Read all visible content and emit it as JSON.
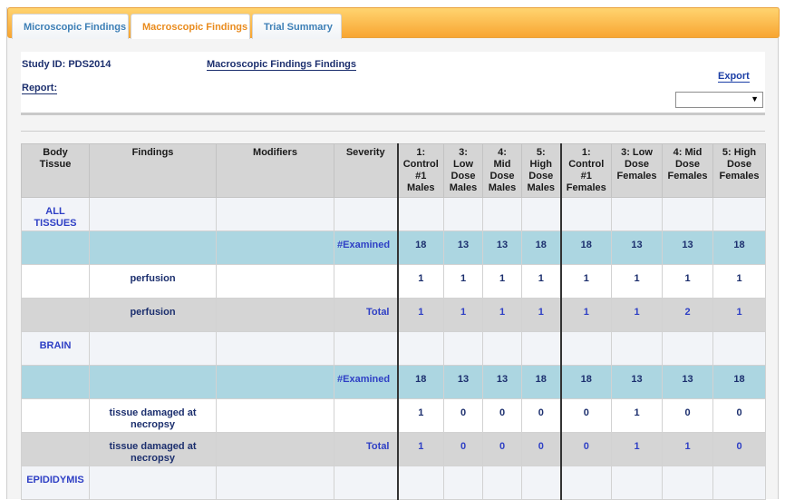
{
  "tabs": [
    {
      "label": "Microscopic Findings",
      "active": false
    },
    {
      "label": "Macroscopic Findings",
      "active": true
    },
    {
      "label": "Trial Summary",
      "active": false
    }
  ],
  "info": {
    "study_id": "Study ID: PDS2014",
    "report_label": "Report:",
    "report_title": "Macroscopic Findings Findings",
    "export_label": "Export",
    "export_select_value": ""
  },
  "table": {
    "headers": [
      [
        "Body",
        "Tissue"
      ],
      [
        "Findings"
      ],
      [
        "Modifiers"
      ],
      [
        "Severity"
      ],
      [
        "1:",
        "Control",
        "#1",
        "Males"
      ],
      [
        "3:",
        "Low",
        "Dose",
        "Males"
      ],
      [
        "4:",
        "Mid",
        "Dose",
        "Males"
      ],
      [
        "5:",
        "High",
        "Dose",
        "Males"
      ],
      [
        "1:",
        "Control",
        "#1",
        "Females"
      ],
      [
        "3: Low",
        "Dose",
        "Females"
      ],
      [
        "4: Mid",
        "Dose",
        "Females"
      ],
      [
        "5: High",
        "Dose",
        "Females"
      ]
    ],
    "rows": [
      {
        "kind": "none",
        "tissue": [
          "ALL",
          "TISSUES"
        ],
        "finding": [],
        "modifier": "",
        "severity": "",
        "counts": [
          "",
          "",
          "",
          "",
          "",
          "",
          "",
          ""
        ]
      },
      {
        "kind": "exam",
        "tissue": [],
        "finding": [],
        "modifier": "",
        "severity": "#Examined",
        "counts": [
          "18",
          "13",
          "13",
          "18",
          "18",
          "13",
          "13",
          "18"
        ]
      },
      {
        "kind": "plain",
        "tissue": [],
        "finding": [
          "perfusion"
        ],
        "modifier": "",
        "severity": "",
        "counts": [
          "1",
          "1",
          "1",
          "1",
          "1",
          "1",
          "1",
          "1"
        ]
      },
      {
        "kind": "total",
        "tissue": [],
        "finding": [
          "perfusion"
        ],
        "modifier": "",
        "severity": "Total",
        "counts": [
          "1",
          "1",
          "1",
          "1",
          "1",
          "1",
          "2",
          "1"
        ]
      },
      {
        "kind": "none",
        "tissue": [
          "BRAIN"
        ],
        "finding": [],
        "modifier": "",
        "severity": "",
        "counts": [
          "",
          "",
          "",
          "",
          "",
          "",
          "",
          ""
        ]
      },
      {
        "kind": "exam",
        "tissue": [],
        "finding": [],
        "modifier": "",
        "severity": "#Examined",
        "counts": [
          "18",
          "13",
          "13",
          "18",
          "18",
          "13",
          "13",
          "18"
        ]
      },
      {
        "kind": "plain",
        "tissue": [],
        "finding": [
          "tissue damaged at",
          "necropsy"
        ],
        "modifier": "",
        "severity": "",
        "counts": [
          "1",
          "0",
          "0",
          "0",
          "0",
          "1",
          "0",
          "0"
        ]
      },
      {
        "kind": "total",
        "tissue": [],
        "finding": [
          "tissue damaged at",
          "necropsy"
        ],
        "modifier": "",
        "severity": "Total",
        "counts": [
          "1",
          "0",
          "0",
          "0",
          "0",
          "1",
          "1",
          "0"
        ]
      },
      {
        "kind": "none",
        "tissue": [
          "EPIDIDYMIS"
        ],
        "finding": [],
        "modifier": "",
        "severity": "",
        "counts": [
          "",
          "",
          "",
          "",
          "",
          "",
          "",
          ""
        ]
      }
    ]
  },
  "colors": {
    "tab_bar": "#f8a531",
    "active_tab_text": "#e98b1d",
    "tab_text": "#3d7fb6",
    "examined_row": "#acd6e1",
    "total_row": "#d5d5d5",
    "link_blue": "#2f40c5"
  },
  "icons": {
    "dropdown": "caret-down-icon"
  }
}
